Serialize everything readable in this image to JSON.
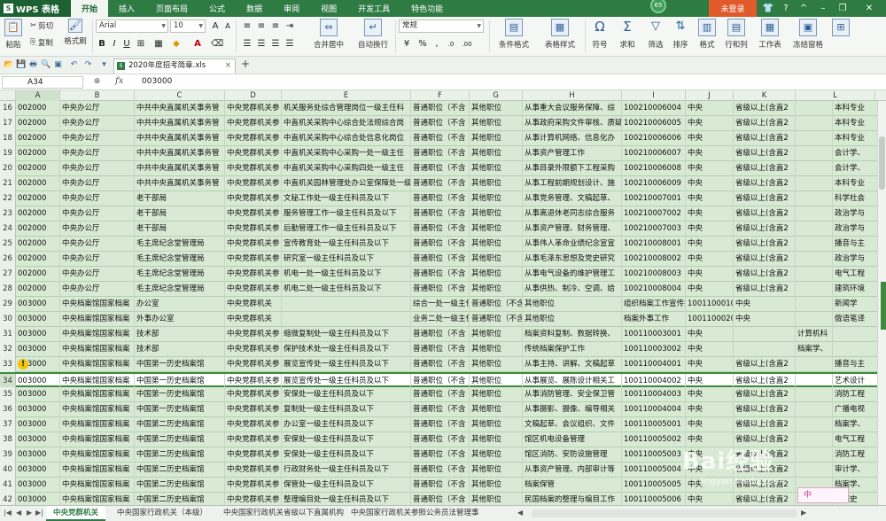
{
  "app": {
    "name": "WPS 表格",
    "badge": "65",
    "login": "未登录"
  },
  "menu_tabs": [
    "开始",
    "插入",
    "页面布局",
    "公式",
    "数据",
    "审阅",
    "视图",
    "开发工具",
    "特色功能"
  ],
  "ribbon": {
    "paste": "粘贴",
    "cut": "剪切",
    "copy": "复制",
    "format_painter": "格式刷",
    "font_name": "Arial",
    "font_size": "10",
    "merge_center": "合并居中",
    "wrap_text": "自动换行",
    "number_format": "常规",
    "conditional_format": "条件格式",
    "table_style": "表格样式",
    "symbol": "符号",
    "sum": "求和",
    "filter": "筛选",
    "sort": "排序",
    "format": "格式",
    "row_col": "行和列",
    "worksheet": "工作表",
    "freeze": "冻结窗格"
  },
  "document_tab": "2020年度招考简章.xls",
  "formula_bar": {
    "cell_ref": "A34",
    "fx": "fx",
    "value": "003000"
  },
  "columns": [
    "A",
    "B",
    "C",
    "D",
    "E",
    "F",
    "G",
    "H",
    "I",
    "J",
    "K",
    "L"
  ],
  "rows": [
    {
      "num": "16",
      "cells": [
        "002000",
        "中央办公厅",
        "中共中央直属机关事务管",
        "中央党群机关参",
        "机关服务处综合管理岗位一级主任科",
        "普通职位（不含",
        "其他职位",
        "从事重大会议服务保障、综",
        "100210006004",
        "中央",
        "省级以上(含直2",
        "",
        "本科专业"
      ]
    },
    {
      "num": "17",
      "cells": [
        "002000",
        "中央办公厅",
        "中共中央直属机关事务管",
        "中央党群机关参",
        "中直机关采购中心综合处法规综合岗",
        "普通职位（不含",
        "其他职位",
        "从事政府采购文件审核、质疑答",
        "100210006005",
        "中央",
        "省级以上(含直2",
        "",
        "本科专业"
      ]
    },
    {
      "num": "18",
      "cells": [
        "002000",
        "中央办公厅",
        "中共中央直属机关事务管",
        "中央党群机关参",
        "中直机关采购中心综合处信息化岗位",
        "普通职位（不含",
        "其他职位",
        "从事计算机网络、信息化办",
        "100210006006",
        "中央",
        "省级以上(含直2",
        "",
        "本科专业"
      ]
    },
    {
      "num": "19",
      "cells": [
        "002000",
        "中央办公厅",
        "中共中央直属机关事务管",
        "中央党群机关参",
        "中直机关采购中心采购一处一级主任",
        "普通职位（不含",
        "其他职位",
        "从事资产管理工作",
        "100210006007",
        "中央",
        "省级以上(含直2",
        "",
        "会计学、"
      ]
    },
    {
      "num": "20",
      "cells": [
        "002000",
        "中央办公厅",
        "中共中央直属机关事务管",
        "中央党群机关参",
        "中直机关采购中心采购四处一级主任",
        "普通职位（不含",
        "其他职位",
        "从事目录外限额下工程采购",
        "100210006008",
        "中央",
        "省级以上(含直2",
        "",
        "会计学、"
      ]
    },
    {
      "num": "21",
      "cells": [
        "002000",
        "中央办公厅",
        "中共中央直属机关事务管",
        "中央党群机关参",
        "中直机关园林管理处办公室保障处一级",
        "普通职位（不含",
        "其他职位",
        "从事工程前期规划设计、施",
        "100210006009",
        "中央",
        "省级以上(含直2",
        "",
        "本科专业"
      ]
    },
    {
      "num": "22",
      "cells": [
        "002000",
        "中央办公厅",
        "老干部局",
        "中央党群机关参",
        "文秘工作处一级主任科员及以下",
        "普通职位（不含",
        "其他职位",
        "从事党务管理、文稿起草、",
        "100210007001",
        "中央",
        "省级以上(含直2",
        "",
        "科学社会"
      ]
    },
    {
      "num": "23",
      "cells": [
        "002000",
        "中央办公厅",
        "老干部局",
        "中央党群机关参",
        "服务管理工作一级主任科员及以下",
        "普通职位（不含",
        "其他职位",
        "从事离退休老同志综合服务",
        "100210007002",
        "中央",
        "省级以上(含直2",
        "",
        "政治学与"
      ]
    },
    {
      "num": "24",
      "cells": [
        "002000",
        "中央办公厅",
        "老干部局",
        "中央党群机关参",
        "后勤管理工作一级主任科员及以下",
        "普通职位（不含",
        "其他职位",
        "从事资产管理、财务管理、",
        "100210007003",
        "中央",
        "省级以上(含直2",
        "",
        "政治学与"
      ]
    },
    {
      "num": "25",
      "cells": [
        "002000",
        "中央办公厅",
        "毛主席纪念堂管理局",
        "中央党群机关参",
        "宣传教育处一级主任科员及以下",
        "普通职位（不含",
        "其他职位",
        "从事伟人革命业绩纪念宣宣",
        "100210008001",
        "中央",
        "省级以上(含直2",
        "",
        "播音与主"
      ]
    },
    {
      "num": "26",
      "cells": [
        "002000",
        "中央办公厅",
        "毛主席纪念堂管理局",
        "中央党群机关参",
        "研究室一级主任科员及以下",
        "普通职位（不含",
        "其他职位",
        "从事毛泽东思想及党史研究",
        "100210008002",
        "中央",
        "省级以上(含直2",
        "",
        "政治学与"
      ]
    },
    {
      "num": "27",
      "cells": [
        "002000",
        "中央办公厅",
        "毛主席纪念堂管理局",
        "中央党群机关参",
        "机电一处一级主任科员及以下",
        "普通职位（不含",
        "其他职位",
        "从事电气设备的维护管理工",
        "100210008003",
        "中央",
        "省级以上(含直2",
        "",
        "电气工程"
      ]
    },
    {
      "num": "28",
      "cells": [
        "002000",
        "中央办公厅",
        "毛主席纪念堂管理局",
        "中央党群机关参",
        "机电二处一级主任科员及以下",
        "普通职位（不含",
        "其他职位",
        "从事供热、制冷、空调、给",
        "100210008004",
        "中央",
        "省级以上(含直2",
        "",
        "建筑环境"
      ]
    },
    {
      "num": "29",
      "cells": [
        "003000",
        "中央档案馆国家档案",
        "办公室",
        "中央党群机关",
        "",
        "综合一处一级主任科员及以下",
        "普通职位（不含",
        "其他职位",
        "组织档案工作宣传报道，研",
        "100110001001",
        "中央",
        "",
        "新闻学"
      ]
    },
    {
      "num": "30",
      "cells": [
        "003000",
        "中央档案馆国家档案",
        "外事办公室",
        "中央党群机关",
        "",
        "业务二处一级主任科员及以下",
        "普通职位（不含",
        "其他职位",
        "档案外事工作",
        "100110002001",
        "中央",
        "",
        "俄语笔译"
      ]
    },
    {
      "num": "31",
      "cells": [
        "003000",
        "中央档案馆国家档案",
        "技术部",
        "中央党群机关参",
        "缩微复制处一级主任科员及以下",
        "普通职位（不含",
        "其他职位",
        "档案资料复制、数据转换、",
        "100110003001",
        "中央",
        "",
        "计算机科"
      ]
    },
    {
      "num": "32",
      "cells": [
        "003000",
        "中央档案馆国家档案",
        "技术部",
        "中央党群机关参",
        "保护技术处一级主任科员及以下",
        "普通职位（不含",
        "其他职位",
        "传统档案保护工作",
        "100110003002",
        "中央",
        "",
        "档案学、"
      ]
    },
    {
      "num": "33",
      "cells": [
        "003000",
        "中央档案馆国家档案",
        "中国第一历史档案馆",
        "中央党群机关参",
        "展览宣传处一级主任科员及以下",
        "普通职位（不含",
        "其他职位",
        "从事主持、讲解、文稿起草",
        "100110004001",
        "中央",
        "省级以上(含直2",
        "",
        "播音与主"
      ]
    },
    {
      "num": "34",
      "cells": [
        "003000",
        "中央档案馆国家档案",
        "中国第一历史档案馆",
        "中央党群机关参",
        "展览宣传处一级主任科员及以下",
        "普通职位（不含",
        "其他职位",
        "从事展览、展陈设计相关工",
        "100110004002",
        "中央",
        "省级以上(含直2",
        "",
        "艺术设计"
      ]
    },
    {
      "num": "35",
      "cells": [
        "003000",
        "中央档案馆国家档案",
        "中国第一历史档案馆",
        "中央党群机关参",
        "安保处一级主任科员及以下",
        "普通职位（不含",
        "其他职位",
        "从事消防管理、安全保卫管",
        "100110004003",
        "中央",
        "省级以上(含直2",
        "",
        "消防工程"
      ]
    },
    {
      "num": "36",
      "cells": [
        "003000",
        "中央档案馆国家档案",
        "中国第一历史档案馆",
        "中央党群机关参",
        "复制处一级主任科员及以下",
        "普通职位（不含",
        "其他职位",
        "从事摄影、摄像、编导相关",
        "100110004004",
        "中央",
        "省级以上(含直2",
        "",
        "广播电视"
      ]
    },
    {
      "num": "37",
      "cells": [
        "003000",
        "中央档案馆国家档案",
        "中国第二历史档案馆",
        "中央党群机关参",
        "办公室一级主任科员及以下",
        "普通职位（不含",
        "其他职位",
        "文稿起草、会议组织、文件",
        "100110005001",
        "中央",
        "省级以上(含直2",
        "",
        "档案学、"
      ]
    },
    {
      "num": "38",
      "cells": [
        "003000",
        "中央档案馆国家档案",
        "中国第二历史档案馆",
        "中央党群机关参",
        "安保处一级主任科员及以下",
        "普通职位（不含",
        "其他职位",
        "馆区机电设备管理",
        "100110005002",
        "中央",
        "省级以上(含直2",
        "",
        "电气工程"
      ]
    },
    {
      "num": "39",
      "cells": [
        "003000",
        "中央档案馆国家档案",
        "中国第二历史档案馆",
        "中央党群机关参",
        "安保处一级主任科员及以下",
        "普通职位（不含",
        "其他职位",
        "馆区消防、安防设施管理",
        "100110005003",
        "中央",
        "省级以上(含直2",
        "",
        "消防工程"
      ]
    },
    {
      "num": "40",
      "cells": [
        "003000",
        "中央档案馆国家档案",
        "中国第二历史档案馆",
        "中央党群机关参",
        "行政财务处一级主任科员及以下",
        "普通职位（不含",
        "其他职位",
        "从事资产管理、内部审计等",
        "100110005004",
        "中央",
        "省级以上(含直2",
        "",
        "审计学、"
      ]
    },
    {
      "num": "41",
      "cells": [
        "003000",
        "中央档案馆国家档案",
        "中国第二历史档案馆",
        "中央党群机关参",
        "保管处一级主任科员及以下",
        "普通职位（不含",
        "其他职位",
        "档案保管",
        "100110005005",
        "中央",
        "省级以上(含直2",
        "",
        "档案学、"
      ]
    },
    {
      "num": "42",
      "cells": [
        "003000",
        "中央档案馆国家档案",
        "中国第二历史档案馆",
        "中央党群机关参",
        "整理编目处一级主任科员及以下",
        "普通职位（不含",
        "其他职位",
        "民国档案的整理与编目工作",
        "100110005006",
        "中央",
        "省级以上(含直2",
        "",
        "中国史"
      ]
    }
  ],
  "sheet_tabs": [
    "中央党群机关",
    "中央国家行政机关（本级）",
    "中央国家行政机关省级以下直属机构",
    "中央国家行政机关参照公务员法管理事"
  ],
  "status_box": "中",
  "watermark": {
    "text": "Bai经验",
    "url": "jingyan.baidu.com"
  }
}
